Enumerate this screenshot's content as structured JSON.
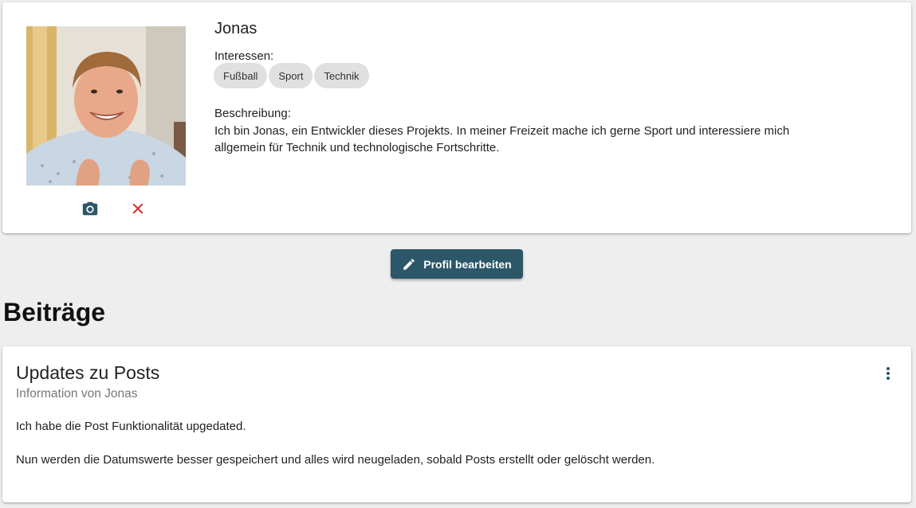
{
  "profile": {
    "name": "Jonas",
    "interests_label": "Interessen:",
    "interests": [
      "Fußball",
      "Sport",
      "Technik"
    ],
    "description_label": "Beschreibung:",
    "description": "Ich bin Jonas, ein Entwickler dieses Projekts. In meiner Freizeit mache ich gerne Sport und interessiere mich allgemein für Technik und technologische Fortschritte.",
    "photo_actions": {
      "camera_icon": "camera-icon",
      "remove_icon": "close-icon"
    }
  },
  "edit_button": {
    "label": "Profil bearbeiten",
    "icon": "pencil-icon"
  },
  "posts_section": {
    "title": "Beiträge"
  },
  "posts": [
    {
      "title": "Updates zu Posts",
      "subtitle": "Information von Jonas",
      "paragraphs": [
        "Ich habe die Post Funktionalität upgedated.",
        "Nun werden die Datumswerte besser gespeichert und alles wird neugeladen, sobald Posts erstellt oder gelöscht werden."
      ],
      "menu_icon": "more-vertical-icon"
    }
  ],
  "colors": {
    "primary": "#2b5769",
    "danger": "#d32f2f",
    "chip": "#e0e0e0",
    "background": "#eeeeee"
  }
}
